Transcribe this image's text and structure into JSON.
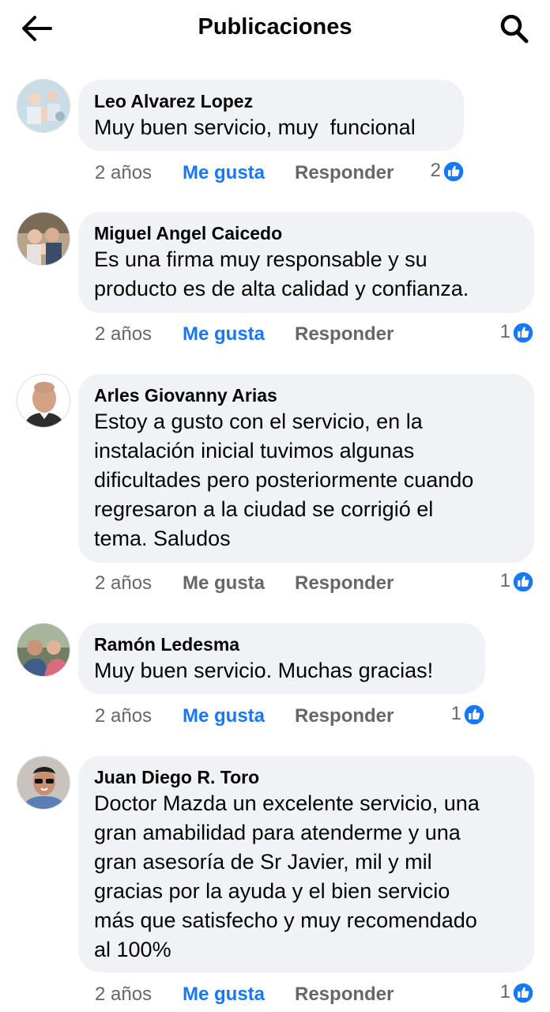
{
  "header": {
    "title": "Publicaciones",
    "back_icon": "arrow-left-icon",
    "search_icon": "search-icon"
  },
  "colors": {
    "link_blue": "#1877f2",
    "bubble": "#f0f2f5",
    "secondary_text": "#65676b"
  },
  "comments": [
    {
      "author": "Leo Alvarez Lopez",
      "text": "Muy buen servicio, muy  funcional",
      "time": "2 años",
      "like_label": "Me gusta",
      "liked": true,
      "reply_label": "Responder",
      "reactions": "2"
    },
    {
      "author": "Miguel Angel Caicedo",
      "text": "Es una firma muy responsable y su\nproducto es de alta calidad y confianza.",
      "time": "2 años",
      "like_label": "Me gusta",
      "liked": true,
      "reply_label": "Responder",
      "reactions": "1"
    },
    {
      "author": "Arles Giovanny Arias",
      "text": "Estoy a gusto con el servicio, en la\ninstalación inicial tuvimos algunas\ndificultades pero posteriormente cuando\nregresaron a la ciudad se corrigió el\ntema. Saludos",
      "time": "2 años",
      "like_label": "Me gusta",
      "liked": false,
      "reply_label": "Responder",
      "reactions": "1"
    },
    {
      "author": "Ramón Ledesma",
      "text": "Muy buen servicio. Muchas gracias!",
      "time": "2 años",
      "like_label": "Me gusta",
      "liked": true,
      "reply_label": "Responder",
      "reactions": "1"
    },
    {
      "author": "Juan Diego R. Toro",
      "text": "Doctor Mazda un excelente servicio, una\ngran amabilidad para atenderme y una\ngran asesoría de Sr Javier, mil y mil\ngracias por la ayuda y el bien servicio\nmás que satisfecho y muy recomendado\nal 100%",
      "time": "2 años",
      "like_label": "Me gusta",
      "liked": true,
      "reply_label": "Responder",
      "reactions": "1"
    }
  ]
}
